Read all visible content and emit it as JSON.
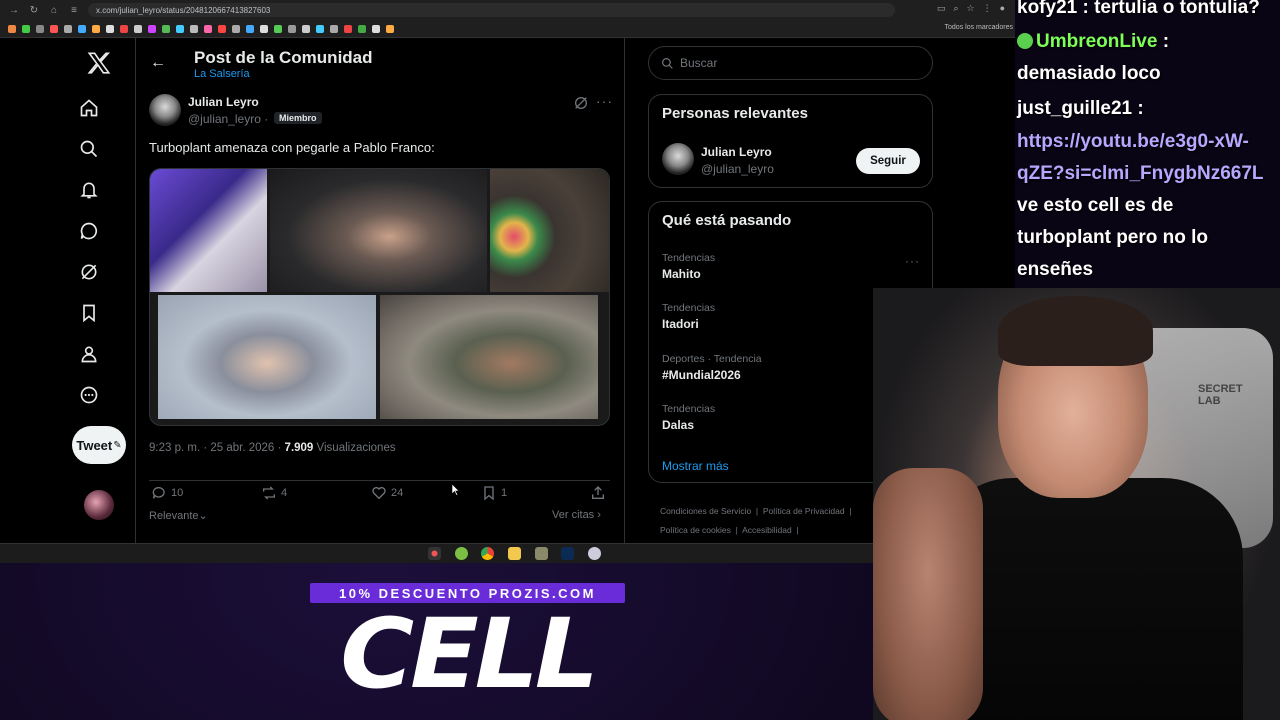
{
  "browser": {
    "url": "x.com/julian_leyro/status/2048120667413827603",
    "bookmarks_label": "Todos los marcadores"
  },
  "nav": {
    "tweet_button_label": "Tweet"
  },
  "post": {
    "header_title": "Post de la Comunidad",
    "community": "La Salsería",
    "author_name": "Julian Leyro",
    "author_handle": "@julian_leyro ·",
    "badge": "Miembro",
    "text": "Turboplant amenaza con pegarle a Pablo Franco:",
    "time": "9:23 p. m. · 25 abr. 2026 ·",
    "views_count": "7.909",
    "views_label": "Visualizaciones",
    "replies": "10",
    "reposts": "4",
    "likes": "24",
    "bookmarks": "1",
    "sort_label": "Relevante",
    "quotes_label": "Ver citas"
  },
  "sidebar": {
    "search_placeholder": "Buscar",
    "relevant_title": "Personas relevantes",
    "relevant_name": "Julian Leyro",
    "relevant_handle": "@julian_leyro",
    "follow_label": "Seguir",
    "trends_title": "Qué está pasando",
    "trends": [
      {
        "category": "Tendencias",
        "name": "Mahito"
      },
      {
        "category": "Tendencias",
        "name": "Itadori"
      },
      {
        "category": "Deportes · Tendencia",
        "name": "#Mundial2026"
      },
      {
        "category": "Tendencias",
        "name": "Dalas"
      }
    ],
    "show_more": "Mostrar más",
    "footer": [
      "Condiciones de Servicio",
      "Política de Privacidad",
      "Política de cookies",
      "Accesibilidad"
    ]
  },
  "chat": {
    "line1": "kofy21 : tertulia o tontulia?",
    "user2": "UmbreonLive",
    "line2_tail": " :",
    "line3": "demasiado loco",
    "line4": "just_guille21 :",
    "link1": "https://youtu.be/e3g0-xW-",
    "link2": "qZE?si=clmi_FnygbNz667L",
    "line7": "ve esto cell es de",
    "line8": "turboplant pero no lo",
    "line9": "enseñes"
  },
  "webcam": {
    "chair_text_1": "SECRET",
    "chair_text_2": "LAB"
  },
  "promo": {
    "discount": "10% DESCUENTO PROZIS.COM",
    "brand": "CELL"
  },
  "colors": {
    "accent": "#1d9bf0",
    "promo_purple": "#6a2bd9",
    "chat_green": "#7dff5a"
  }
}
